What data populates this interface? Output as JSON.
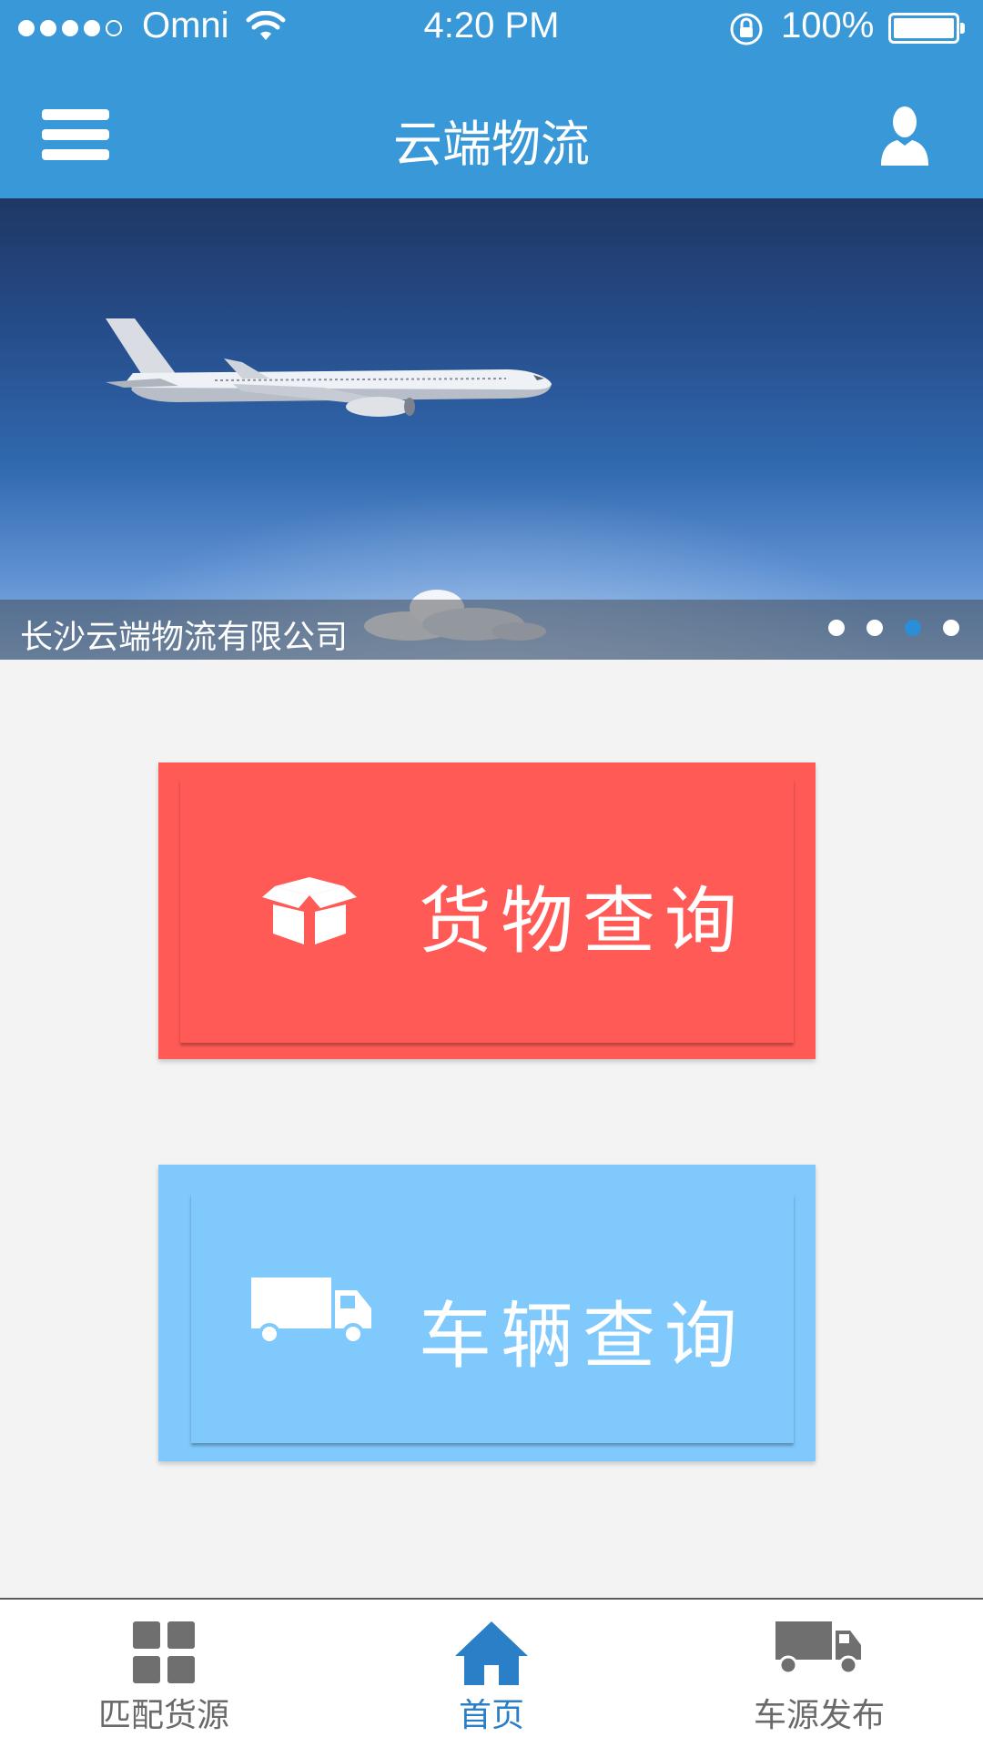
{
  "status_bar": {
    "carrier": "Omni",
    "time": "4:20 PM",
    "battery_percent": "100%",
    "signal_bars_filled": 4,
    "signal_bars_total": 5
  },
  "header": {
    "title": "云端物流",
    "menu_icon": "hamburger-menu-icon",
    "user_icon": "user-profile-icon"
  },
  "banner": {
    "caption": "长沙云端物流有限公司",
    "slide_count": 4,
    "active_slide": 3
  },
  "tiles": {
    "cargo": {
      "label": "货物查询",
      "icon": "box-icon",
      "color": "#ff5a55"
    },
    "vehicle": {
      "label": "车辆查询",
      "icon": "truck-icon",
      "color": "#80c9fc"
    }
  },
  "bottom_nav": {
    "items": [
      {
        "label": "匹配货源",
        "icon": "grid-icon",
        "active": false
      },
      {
        "label": "首页",
        "icon": "home-icon",
        "active": true
      },
      {
        "label": "车源发布",
        "icon": "truck-icon",
        "active": false
      }
    ]
  },
  "colors": {
    "primary": "#3898d8",
    "nav_active": "#2a7fc6",
    "background": "#f3f3f3"
  }
}
